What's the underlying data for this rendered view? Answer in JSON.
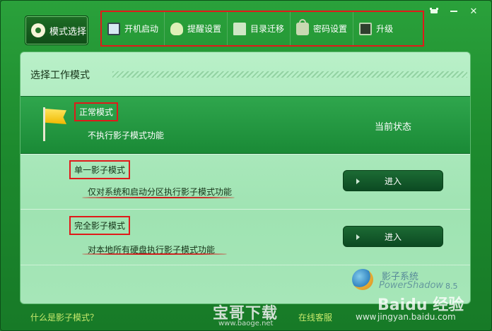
{
  "window": {
    "min_icon": "pin-icon",
    "close_glyph": "✕"
  },
  "nav": {
    "mode_select": "模式选择",
    "tools": [
      {
        "label": "开机启动",
        "icon": "monitor-icon"
      },
      {
        "label": "提醒设置",
        "icon": "bulb-icon"
      },
      {
        "label": "目录迁移",
        "icon": "folder-icon"
      },
      {
        "label": "密码设置",
        "icon": "lock-icon"
      },
      {
        "label": "升级",
        "icon": "phone-icon"
      }
    ]
  },
  "panel": {
    "title": "选择工作模式",
    "modes": [
      {
        "name": "正常模式",
        "desc": "不执行影子模式功能",
        "status": "当前状态"
      },
      {
        "name": "单一影子模式",
        "desc": "仅对系统和启动分区执行影子模式功能",
        "button": "进入"
      },
      {
        "name": "完全影子模式",
        "desc": "对本地所有硬盘执行影子模式功能",
        "button": "进入"
      }
    ]
  },
  "logo": {
    "name": "影子系统",
    "tagline": "PowerShadow",
    "version": "8.5"
  },
  "footer": {
    "what_is": "什么是影子模式？",
    "online_service": "在线客服"
  },
  "watermarks": {
    "site_main": "宝哥下载",
    "site_url": "www.baoge.net",
    "baidu_main": "Baidu 经验",
    "baidu_url": "jingyan.baidu.com",
    "www_prefix": "www"
  },
  "colors": {
    "accent_green": "#1d8a2e",
    "highlight_red": "#e01a1a",
    "link_yellow": "#c7e96c"
  }
}
